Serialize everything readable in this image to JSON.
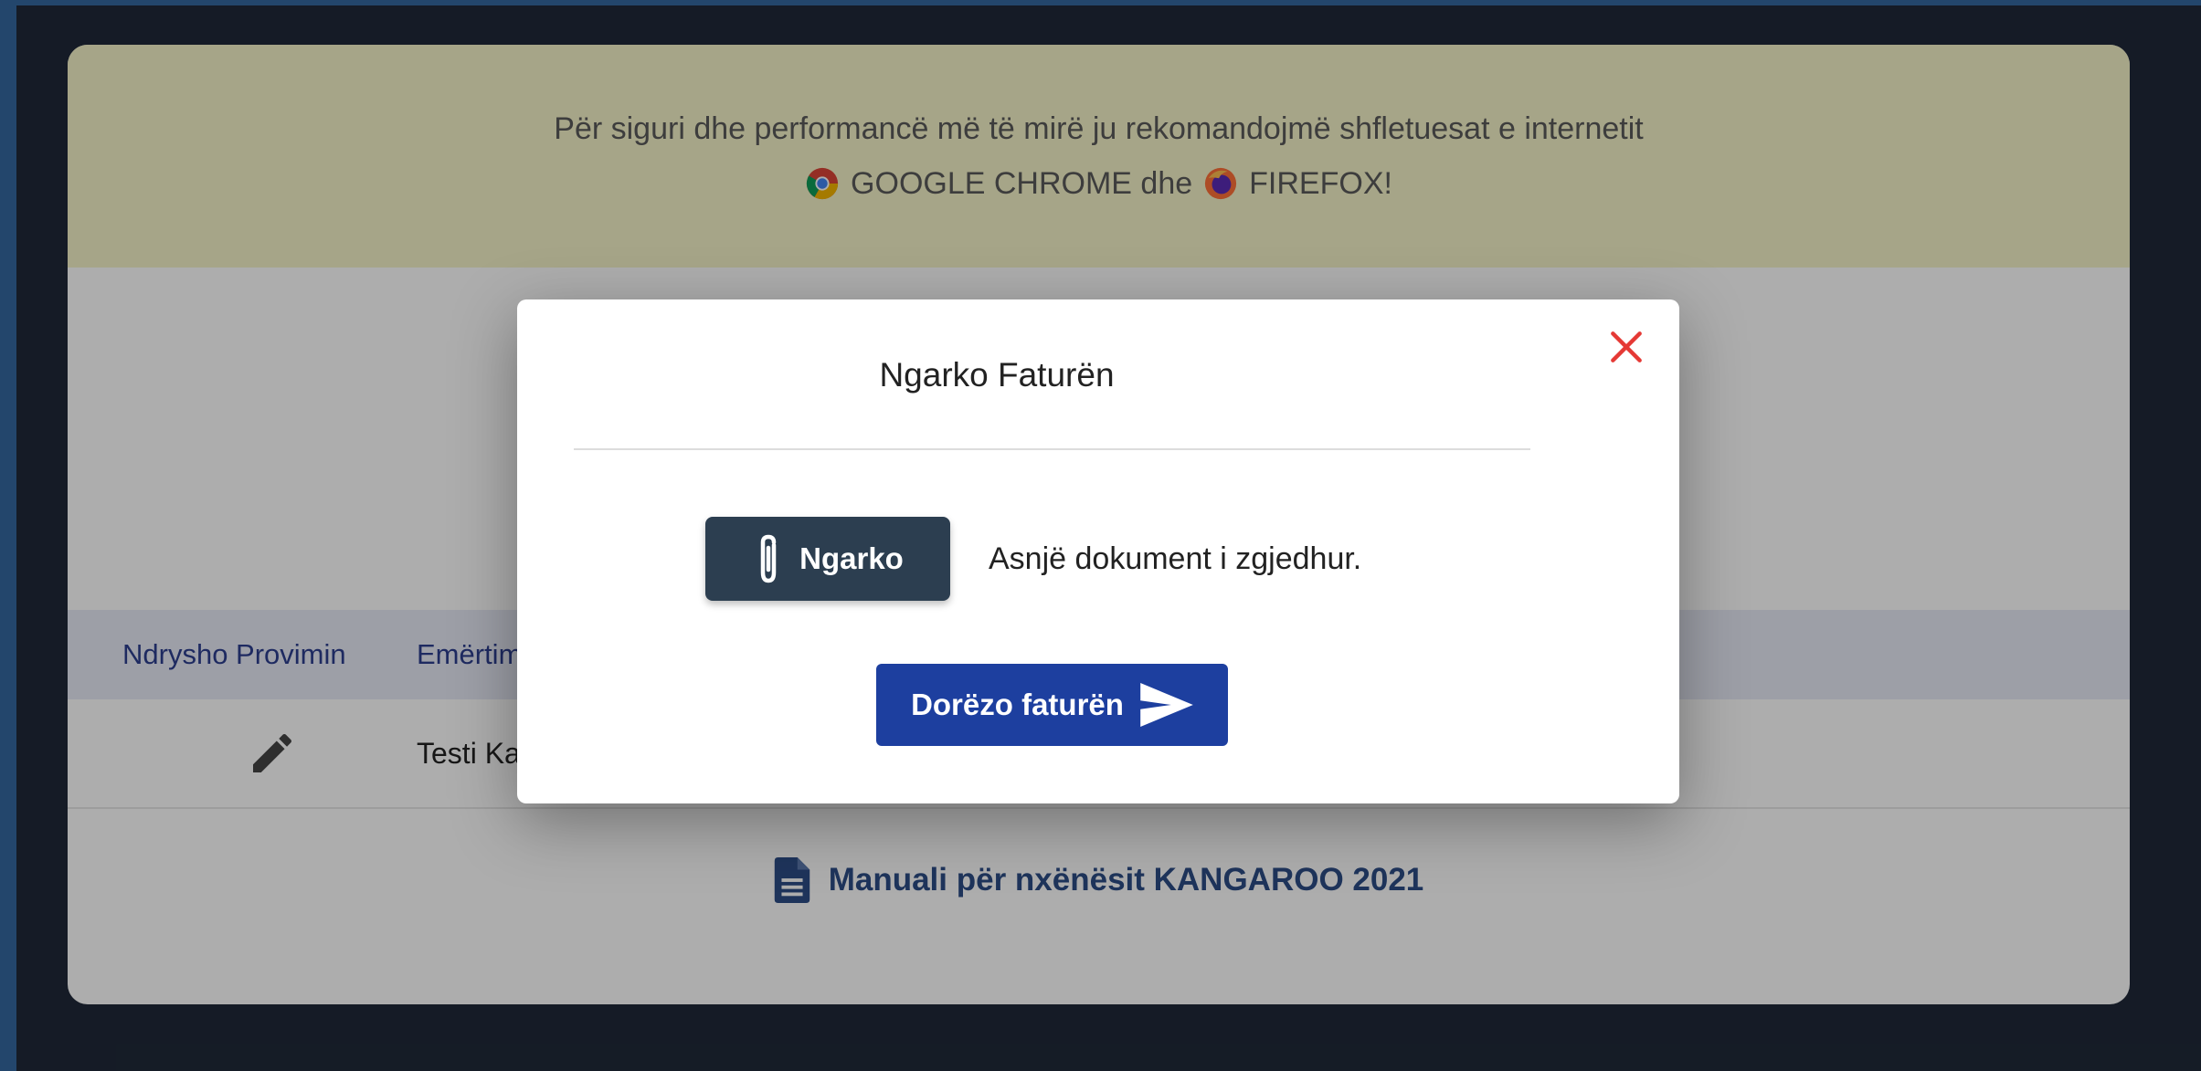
{
  "banner": {
    "line1": "Për siguri dhe performancë më të mirë ju rekomandojmë shfletuesat e internetit",
    "chrome_label": "GOOGLE CHROME dhe",
    "firefox_label": "FIREFOX!"
  },
  "table": {
    "headers": [
      "Ndrysho Provimin",
      "Emërtimi"
    ],
    "rows": [
      {
        "edit_icon": "pencil-icon",
        "name": "Testi Kangaroo"
      }
    ]
  },
  "footer": {
    "manual_link": "Manuali për nxënësit KANGAROO 2021",
    "icon": "document-icon"
  },
  "modal": {
    "title": "Ngarko Faturën",
    "upload_label": "Ngarko",
    "file_status": "Asnjë dokument i zgjedhur.",
    "submit_label": "Dorëzo faturën",
    "close_icon": "close-icon"
  },
  "colors": {
    "banner_bg": "#f5f3c9",
    "upload_button": "#2c3e50",
    "submit_button": "#1d3f9f",
    "close_icon": "#e53935",
    "outer_border": "#3467a0",
    "page_bg": "#1f2938"
  }
}
